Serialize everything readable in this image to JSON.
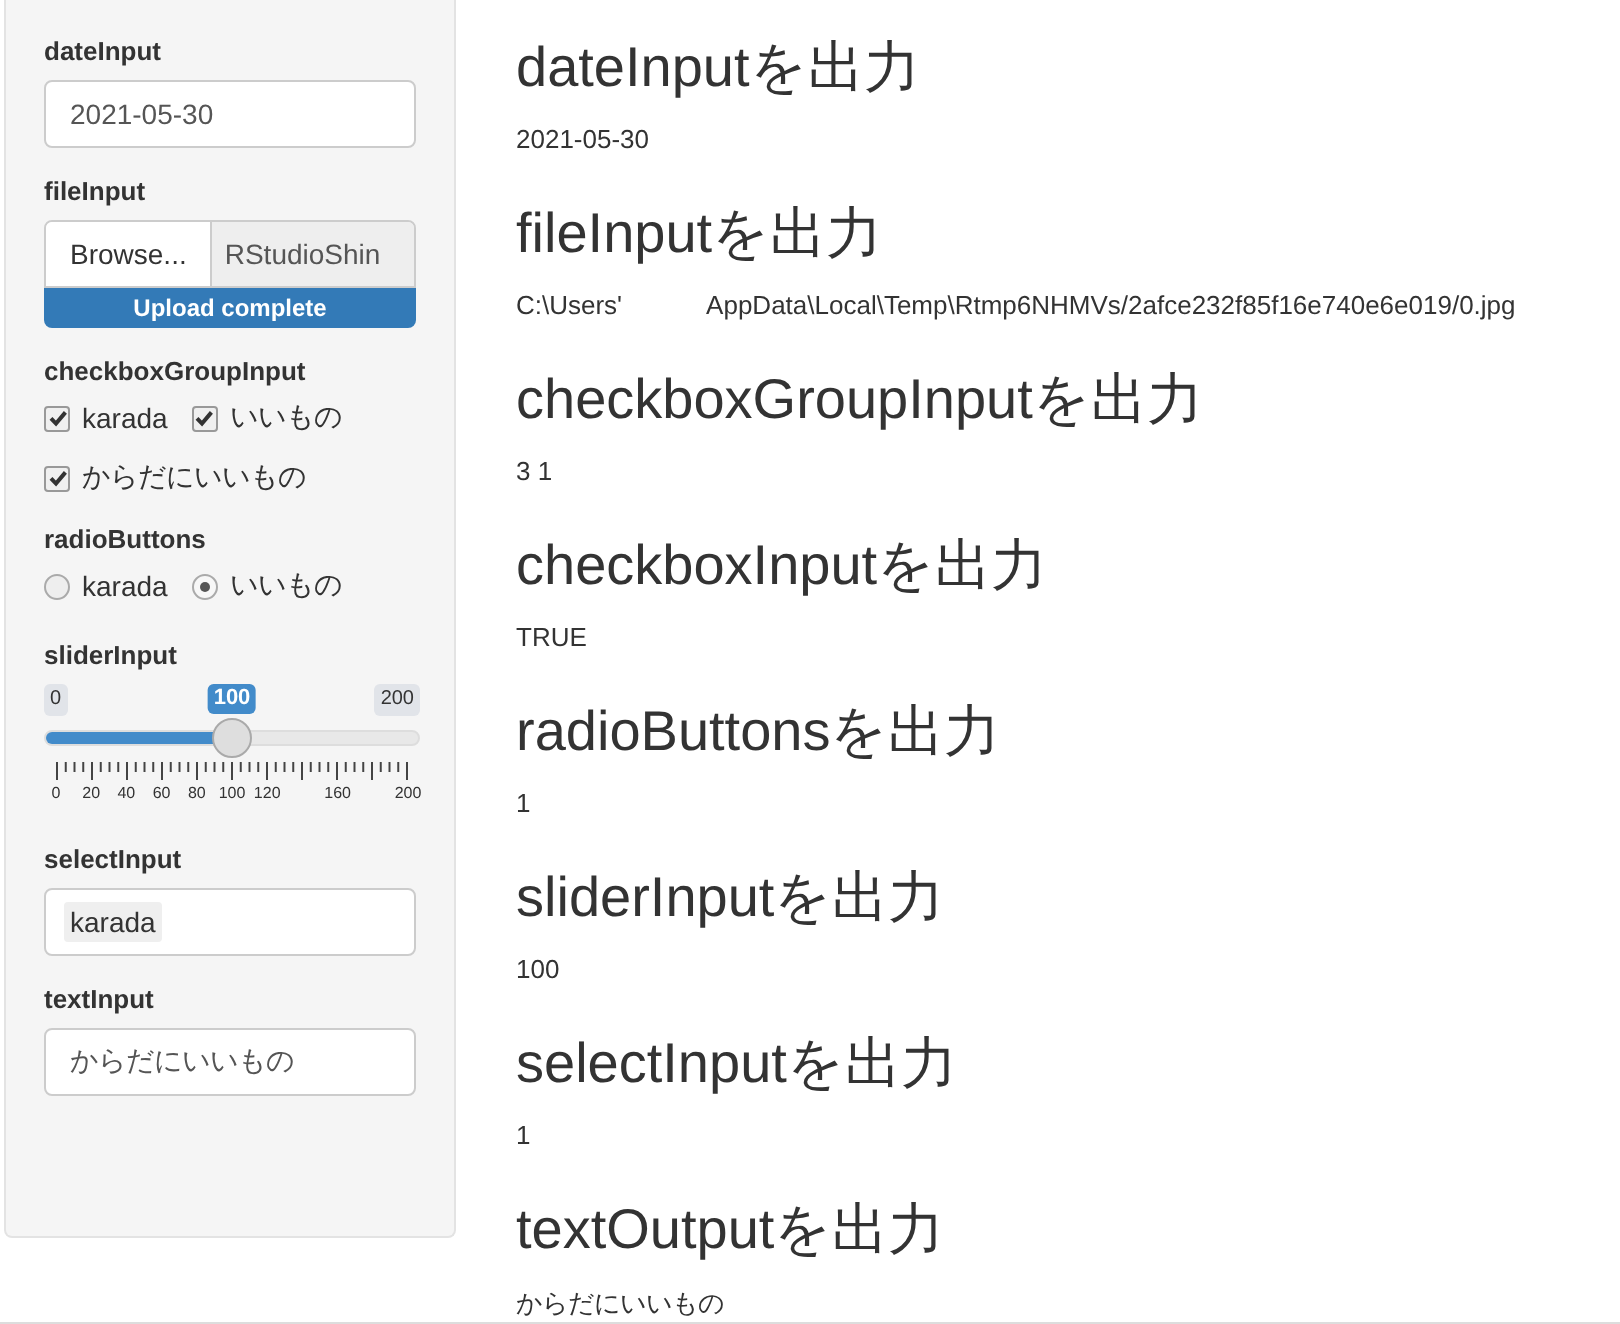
{
  "sidebar": {
    "inputs": [
      {
        "kind": "date",
        "label": "dateInput",
        "value": "2021-05-30"
      },
      {
        "kind": "file",
        "label": "fileInput",
        "button": "Browse...",
        "filename": "RStudioShin",
        "progress": "Upload complete",
        "level": 1
      },
      {
        "kind": "checkbox_group",
        "label": "checkboxGroupInput",
        "options": [
          {
            "label": "karada",
            "checked": true
          },
          {
            "label": "いいもの",
            "checked": true
          },
          {
            "label": "からだにいいもの",
            "checked": true
          }
        ]
      },
      {
        "kind": "radio",
        "label": "radioButtons",
        "options": [
          {
            "label": "karada",
            "selected": false
          },
          {
            "label": "いいもの",
            "selected": true
          }
        ]
      },
      {
        "kind": "slider",
        "label": "sliderInput",
        "min": "0",
        "max": "200",
        "value": "100",
        "level": 0.5,
        "tick_labels": [
          "0",
          "20",
          "40",
          "60",
          "80",
          "100",
          "120",
          "160",
          "200"
        ]
      },
      {
        "kind": "select",
        "label": "selectInput",
        "value": "karada"
      },
      {
        "kind": "text",
        "label": "textInput",
        "value": "からだにいいもの"
      }
    ]
  },
  "main": {
    "outputs": [
      {
        "heading": "dateInputを出力",
        "parts": [
          "2021-05-30"
        ]
      },
      {
        "heading": "fileInputを出力",
        "parts": [
          "C:\\Users'",
          "AppData\\Local\\Temp\\Rtmp6NHMVs/2afce232f85f16e740e6e019/0.jpg"
        ]
      },
      {
        "heading": "checkboxGroupInputを出力",
        "parts": [
          "3 1"
        ]
      },
      {
        "heading": "checkboxInputを出力",
        "parts": [
          "TRUE"
        ]
      },
      {
        "heading": "radioButtonsを出力",
        "parts": [
          "1"
        ]
      },
      {
        "heading": "sliderInputを出力",
        "parts": [
          "100"
        ]
      },
      {
        "heading": "selectInputを出力",
        "parts": [
          "1"
        ]
      },
      {
        "heading": "textOutputを出力",
        "parts": [
          "からだにいいもの"
        ]
      }
    ]
  }
}
